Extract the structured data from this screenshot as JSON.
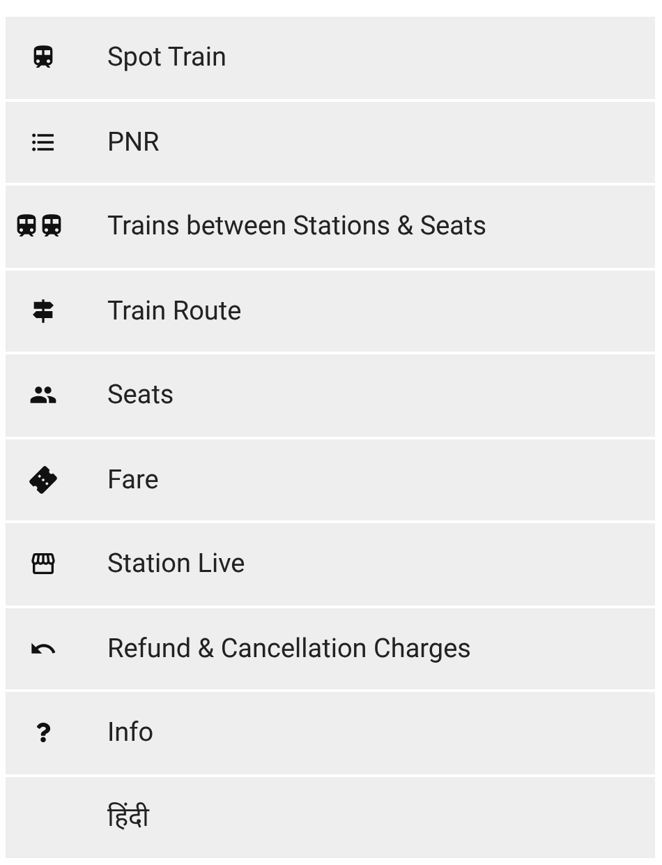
{
  "menu": {
    "items": [
      {
        "label": "Spot Train"
      },
      {
        "label": "PNR"
      },
      {
        "label": "Trains between Stations & Seats"
      },
      {
        "label": "Train Route"
      },
      {
        "label": "Seats"
      },
      {
        "label": "Fare"
      },
      {
        "label": "Station Live"
      },
      {
        "label": "Refund & Cancellation Charges"
      },
      {
        "label": "Info"
      },
      {
        "label": "हिंदी"
      }
    ]
  }
}
